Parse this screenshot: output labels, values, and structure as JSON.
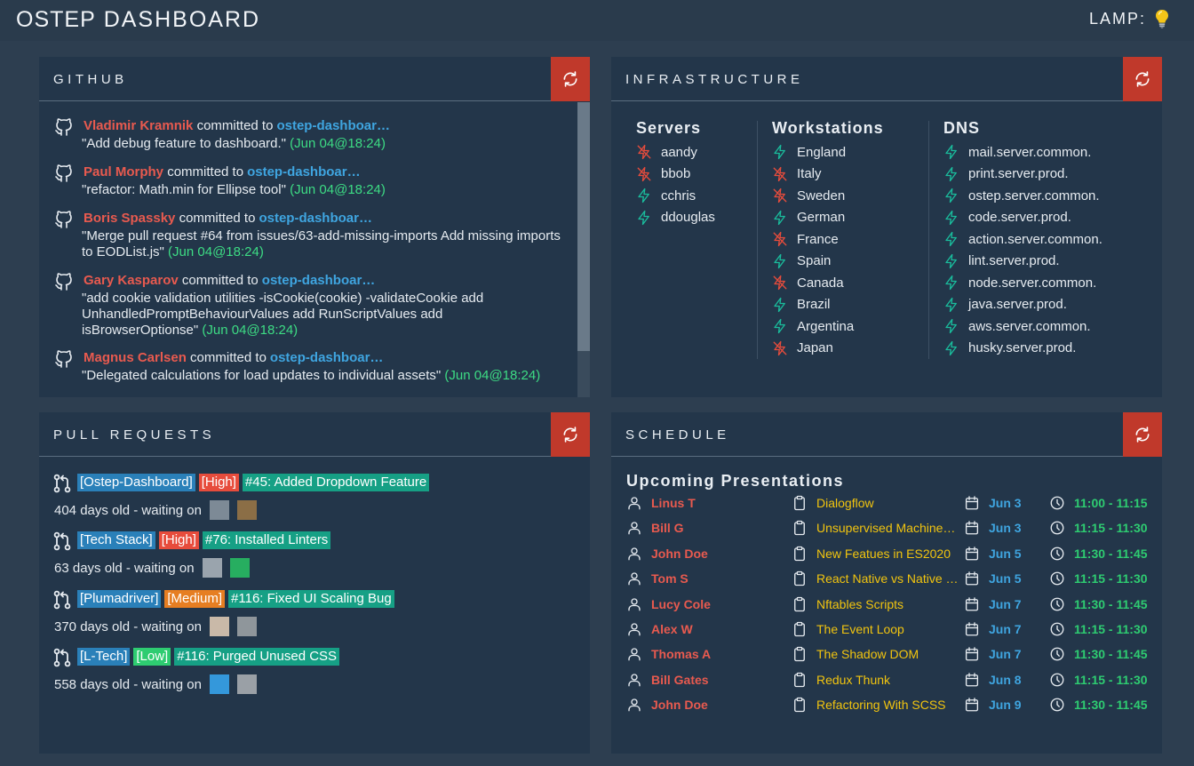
{
  "header": {
    "brand_main": "OSTEP",
    "brand_sub": "DASHBOARD",
    "lamp_label": "LAMP:"
  },
  "github": {
    "title": "GITHUB",
    "commits": [
      {
        "author": "Vladimir Kramnik",
        "verb": "committed to",
        "repo": "ostep-dashboar…",
        "message": "\"Add debug feature to dashboard.\"",
        "time": "(Jun 04@18:24)"
      },
      {
        "author": "Paul Morphy",
        "verb": "committed to",
        "repo": "ostep-dashboar…",
        "message": "\"refactor: Math.min for Ellipse tool\"",
        "time": "(Jun 04@18:24)"
      },
      {
        "author": "Boris Spassky",
        "verb": "committed to",
        "repo": "ostep-dashboar…",
        "message": "\"Merge pull request #64 from issues/63-add-missing-imports Add missing imports to EODList.js\"",
        "time": "(Jun 04@18:24)"
      },
      {
        "author": "Gary Kasparov",
        "verb": "committed to",
        "repo": "ostep-dashboar…",
        "message": "\"add cookie validation utilities -isCookie(cookie) -validateCookie add UnhandledPromptBehaviourValues add RunScriptValues add isBrowserOptionse\"",
        "time": "(Jun 04@18:24)"
      },
      {
        "author": "Magnus Carlsen",
        "verb": "committed to",
        "repo": "ostep-dashboar…",
        "message": "\"Delegated calculations for load updates to individual assets\"",
        "time": "(Jun 04@18:24)"
      }
    ]
  },
  "infrastructure": {
    "title": "INFRASTRUCTURE",
    "columns": [
      {
        "heading": "Servers",
        "items": [
          {
            "name": "aandy",
            "up": false
          },
          {
            "name": "bbob",
            "up": false
          },
          {
            "name": "cchris",
            "up": true
          },
          {
            "name": "ddouglas",
            "up": true
          }
        ]
      },
      {
        "heading": "Workstations",
        "items": [
          {
            "name": "England",
            "up": true
          },
          {
            "name": "Italy",
            "up": false
          },
          {
            "name": "Sweden",
            "up": false
          },
          {
            "name": "German",
            "up": true
          },
          {
            "name": "France",
            "up": false
          },
          {
            "name": "Spain",
            "up": true
          },
          {
            "name": "Canada",
            "up": false
          },
          {
            "name": "Brazil",
            "up": true
          },
          {
            "name": "Argentina",
            "up": true
          },
          {
            "name": "Japan",
            "up": false
          }
        ]
      },
      {
        "heading": "DNS",
        "items": [
          {
            "name": "mail.server.common.",
            "up": true
          },
          {
            "name": "print.server.prod.",
            "up": true
          },
          {
            "name": "ostep.server.common.",
            "up": true
          },
          {
            "name": "code.server.prod.",
            "up": true
          },
          {
            "name": "action.server.common.",
            "up": true
          },
          {
            "name": "lint.server.prod.",
            "up": true
          },
          {
            "name": "node.server.common.",
            "up": true
          },
          {
            "name": "java.server.prod.",
            "up": true
          },
          {
            "name": "aws.server.common.",
            "up": true
          },
          {
            "name": "husky.server.prod.",
            "up": true
          }
        ]
      }
    ]
  },
  "pull_requests": {
    "title": "PULL REQUESTS",
    "items": [
      {
        "repo": "[Ostep-Dashboard]",
        "priority": "[High]",
        "priority_level": "high",
        "pr": "#45: Added Dropdown Feature",
        "age": "404 days old - waiting on"
      },
      {
        "repo": "[Tech Stack]",
        "priority": "[High]",
        "priority_level": "high",
        "pr": "#76: Installed Linters",
        "age": "63 days old - waiting on"
      },
      {
        "repo": "[Plumadriver]",
        "priority": "[Medium]",
        "priority_level": "medium",
        "pr": "#116: Fixed UI Scaling Bug",
        "age": "370 days old - waiting on"
      },
      {
        "repo": "[L-Tech]",
        "priority": "[Low]",
        "priority_level": "low",
        "pr": "#116: Purged Unused CSS",
        "age": "558 days old - waiting on"
      }
    ]
  },
  "schedule": {
    "title": "SCHEDULE",
    "subtitle": "Upcoming Presentations",
    "rows": [
      {
        "name": "Linus T",
        "topic": "Dialogflow",
        "date": "Jun 3",
        "time": "11:00 - 11:15"
      },
      {
        "name": "Bill G",
        "topic": "Unsupervised Machine L…",
        "date": "Jun 3",
        "time": "11:15 - 11:30"
      },
      {
        "name": "John Doe",
        "topic": "New Featues in ES2020",
        "date": "Jun 5",
        "time": "11:30 - 11:45"
      },
      {
        "name": "Tom S",
        "topic": "React Native vs Native S…",
        "date": "Jun 5",
        "time": "11:15 - 11:30"
      },
      {
        "name": "Lucy Cole",
        "topic": "Nftables Scripts",
        "date": "Jun 7",
        "time": "11:30 - 11:45"
      },
      {
        "name": "Alex W",
        "topic": "The Event Loop",
        "date": "Jun 7",
        "time": "11:15 - 11:30"
      },
      {
        "name": "Thomas A",
        "topic": "The Shadow DOM",
        "date": "Jun 7",
        "time": "11:30 - 11:45"
      },
      {
        "name": "Bill Gates",
        "topic": "Redux Thunk",
        "date": "Jun 8",
        "time": "11:15 - 11:30"
      },
      {
        "name": "John Doe",
        "topic": "Refactoring With SCSS",
        "date": "Jun 9",
        "time": "11:30 - 11:45"
      }
    ]
  },
  "colors": {
    "accent_red": "#c0392b",
    "up_green": "#1abc9c",
    "down_red": "#e74c3c"
  }
}
